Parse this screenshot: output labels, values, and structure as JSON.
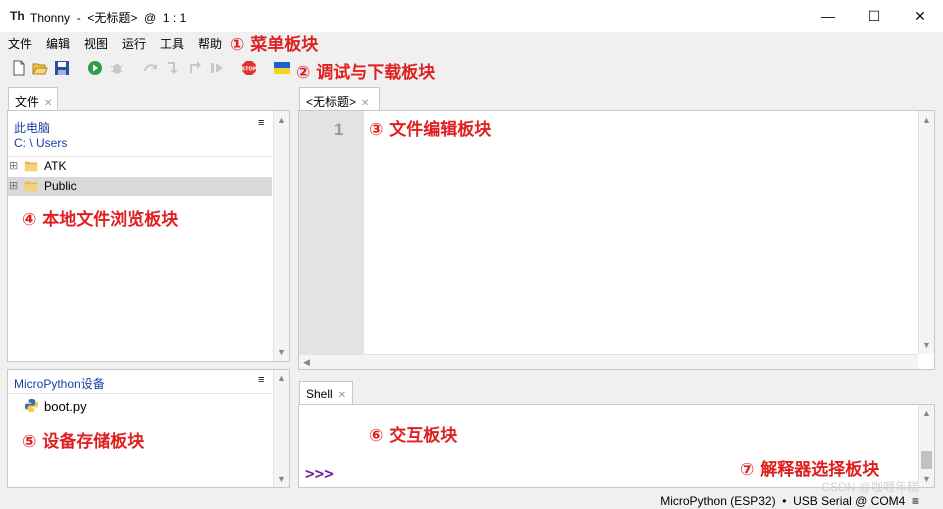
{
  "window": {
    "logo": "Th",
    "title": "Thonny  -  <无标题>  @  1 : 1",
    "minimize": "—",
    "maximize": "☐",
    "close": "✕"
  },
  "menu": {
    "items": [
      "文件",
      "编辑",
      "视图",
      "运行",
      "工具",
      "帮助"
    ]
  },
  "annotations": {
    "a1": "① 菜单板块",
    "a2": "② 调试与下载板块",
    "a3": "③ 文件编辑板块",
    "a4": "④ 本地文件浏览板块",
    "a5": "⑤ 设备存储板块",
    "a6": "⑥ 交互板块",
    "a7": "⑦ 解释器选择板块"
  },
  "files_pane": {
    "tab_label": "文件",
    "section_title": "此电脑",
    "path": "C: \\ Users",
    "menu_icon": "≡",
    "items": [
      {
        "label": "ATK",
        "expand": "⊞"
      },
      {
        "label": "Public",
        "expand": "⊞"
      }
    ]
  },
  "device_pane": {
    "section_title": "MicroPython设备",
    "menu_icon": "≡",
    "items": [
      {
        "label": "boot.py"
      }
    ]
  },
  "editor": {
    "tab_label": "<无标题>",
    "line_numbers": [
      "1"
    ]
  },
  "shell": {
    "tab_label": "Shell",
    "prompt": ">>>"
  },
  "status": {
    "text": "MicroPython (ESP32)  •  USB Serial @ COM4  ≡"
  },
  "watermark": "CSDN @咖喱年糕",
  "colors": {
    "annotation": "#e02020",
    "link_blue": "#1a3ea8",
    "prompt_purple": "#7a1fa2",
    "selection": "#d9d9d9"
  }
}
